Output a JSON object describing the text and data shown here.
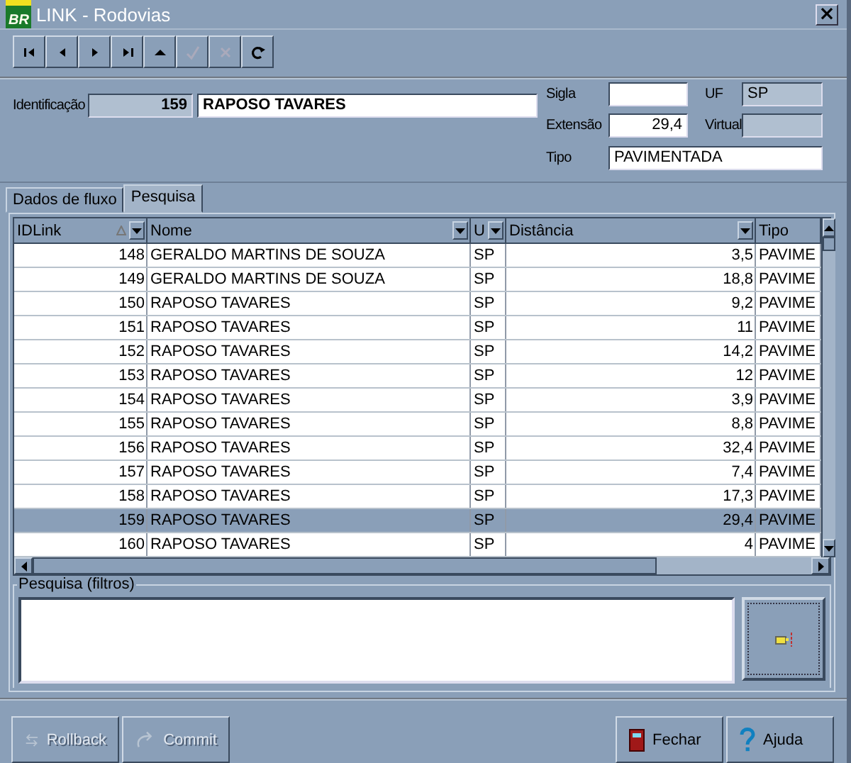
{
  "window": {
    "logo_text": "BR",
    "title": "LINK - Rodovias",
    "close": "×"
  },
  "toolbar": [
    {
      "kind": "first",
      "disabled": false
    },
    {
      "kind": "prior",
      "disabled": false
    },
    {
      "kind": "next",
      "disabled": false
    },
    {
      "kind": "last",
      "disabled": false
    },
    {
      "kind": "up",
      "disabled": false
    },
    {
      "kind": "post",
      "disabled": true
    },
    {
      "kind": "cancel",
      "disabled": true
    },
    {
      "kind": "refresh",
      "disabled": false
    }
  ],
  "record": {
    "id_label": "Identificação",
    "id": "159",
    "name": "RAPOSO TAVARES",
    "sigla_label": "Sigla",
    "uf_label": "UF",
    "uf": "SP",
    "extensao_label": "Extensão",
    "extensao": "29,4",
    "virtual_label": "Virtual",
    "tipo_label": "Tipo",
    "tipo": "PAVIMENTADA"
  },
  "tabs": [
    {
      "label": "Dados de fluxo",
      "selected": false
    },
    {
      "label": "Pesquisa",
      "selected": true
    }
  ],
  "table": {
    "columns": [
      {
        "label": "IDLink",
        "sorted": true,
        "dropdown": true
      },
      {
        "label": "Nome",
        "sorted": false,
        "dropdown": true
      },
      {
        "label": "U",
        "sorted": false,
        "dropdown": true
      },
      {
        "label": "Distância",
        "sorted": false,
        "dropdown": true
      },
      {
        "label": "Tipo",
        "sorted": false,
        "dropdown": false
      }
    ],
    "rows": [
      {
        "cells": [
          "148",
          "GERALDO MARTINS DE SOUZA",
          "SP",
          "3,5",
          "PAVIME"
        ],
        "selected": false
      },
      {
        "cells": [
          "149",
          "GERALDO MARTINS DE SOUZA",
          "SP",
          "18,8",
          "PAVIME"
        ],
        "selected": false
      },
      {
        "cells": [
          "150",
          "RAPOSO TAVARES",
          "SP",
          "9,2",
          "PAVIME"
        ],
        "selected": false
      },
      {
        "cells": [
          "151",
          "RAPOSO TAVARES",
          "SP",
          "11",
          "PAVIME"
        ],
        "selected": false
      },
      {
        "cells": [
          "152",
          "RAPOSO TAVARES",
          "SP",
          "14,2",
          "PAVIME"
        ],
        "selected": false
      },
      {
        "cells": [
          "153",
          "RAPOSO TAVARES",
          "SP",
          "12",
          "PAVIME"
        ],
        "selected": false
      },
      {
        "cells": [
          "154",
          "RAPOSO TAVARES",
          "SP",
          "3,9",
          "PAVIME"
        ],
        "selected": false
      },
      {
        "cells": [
          "155",
          "RAPOSO TAVARES",
          "SP",
          "8,8",
          "PAVIME"
        ],
        "selected": false
      },
      {
        "cells": [
          "156",
          "RAPOSO TAVARES",
          "SP",
          "32,4",
          "PAVIME"
        ],
        "selected": false
      },
      {
        "cells": [
          "157",
          "RAPOSO TAVARES",
          "SP",
          "7,4",
          "PAVIME"
        ],
        "selected": false
      },
      {
        "cells": [
          "158",
          "RAPOSO TAVARES",
          "SP",
          "17,3",
          "PAVIME"
        ],
        "selected": false
      },
      {
        "cells": [
          "159",
          "RAPOSO TAVARES",
          "SP",
          "29,4",
          "PAVIME"
        ],
        "selected": true
      },
      {
        "cells": [
          "160",
          "RAPOSO TAVARES",
          "SP",
          "4",
          "PAVIME"
        ],
        "selected": false
      }
    ]
  },
  "filters": {
    "title": "Pesquisa (filtros)"
  },
  "buttons": [
    {
      "kind": "rollback",
      "label": "Rollback",
      "disabled": true
    },
    {
      "kind": "commit",
      "label": "Commit",
      "disabled": true
    },
    {
      "kind": "close",
      "label": "Fechar",
      "disabled": false
    },
    {
      "kind": "help",
      "label": "Ajuda",
      "disabled": false
    }
  ]
}
